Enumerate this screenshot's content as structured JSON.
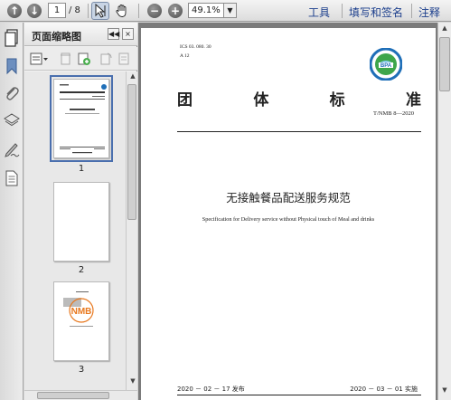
{
  "toolbar": {
    "page_current": "1",
    "page_total": "/ 8",
    "zoom_value": "49.1%",
    "zoom_dropdown": "▼",
    "links": {
      "tools": "工具",
      "fill_sign": "填写和签名",
      "comment": "注释"
    },
    "icons": {
      "back": "back-arrow-icon",
      "next": "next-arrow-icon",
      "select": "select-cursor-icon",
      "hand": "hand-tool-icon",
      "zoom_out": "zoom-out-icon",
      "zoom_in": "zoom-in-icon"
    }
  },
  "panel": {
    "title": "页面缩略图",
    "collapse_label": "◀◀",
    "close_label": "×",
    "thumbnails": [
      {
        "number": "1"
      },
      {
        "number": "2"
      },
      {
        "number": "3"
      }
    ]
  },
  "document": {
    "ics": "ICS  03. 080. 30",
    "ccs": "A  12",
    "logo_text": "BPA",
    "standard_chars": [
      "团",
      "体",
      "标",
      "准"
    ],
    "code": "T/NMB 8—2020",
    "title_cn": "无接触餐品配送服务规范",
    "title_en": "Specification for Delivery service without Physical touch of Meal and drinks",
    "publish_date": "2020 － 02 － 17 发布",
    "implement_date": "2020 － 03 － 01 实施"
  },
  "colors": {
    "link": "#1b3e8c",
    "logo_blue": "#1f6fb8",
    "logo_green": "#3ea64a",
    "thumb3_orange": "#e8781e"
  }
}
